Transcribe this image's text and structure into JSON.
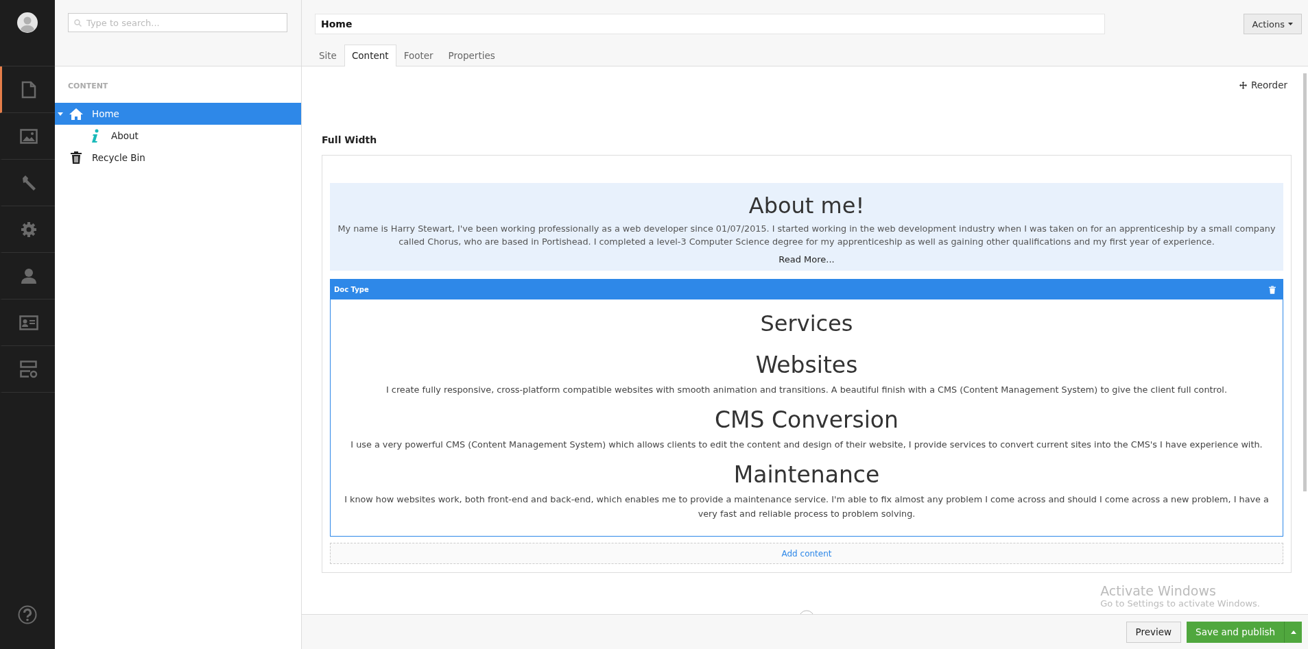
{
  "rail": {
    "items": [
      {
        "kind": "document",
        "selected": true
      },
      {
        "kind": "image",
        "selected": false
      },
      {
        "kind": "wrench",
        "selected": false
      },
      {
        "kind": "gear",
        "selected": false
      },
      {
        "kind": "user",
        "selected": false
      },
      {
        "kind": "card",
        "selected": false
      },
      {
        "kind": "server",
        "selected": false
      }
    ]
  },
  "search": {
    "placeholder": "Type to search..."
  },
  "tree": {
    "heading": "CONTENT",
    "items": [
      {
        "label": "Home",
        "kind": "home",
        "selected": true,
        "expanded": true,
        "children": [
          {
            "label": "About",
            "kind": "info",
            "selected": false
          }
        ]
      },
      {
        "label": "Recycle Bin",
        "kind": "trash",
        "selected": false
      }
    ]
  },
  "editor": {
    "title": "Home",
    "actions": "Actions",
    "tabs": [
      {
        "label": "Site",
        "selected": false
      },
      {
        "label": "Content",
        "selected": true
      },
      {
        "label": "Footer",
        "selected": false
      },
      {
        "label": "Properties",
        "selected": false
      }
    ],
    "reorder": "Reorder",
    "section": "Full Width",
    "blocks": [
      {
        "kind": "intro",
        "heading": "About me!",
        "text": "My name is Harry Stewart, I've been working professionally as a web developer since 01/07/2015. I started working in the web development industry when I was taken on for an apprenticeship by a small company called Chorus, who are based in Portishead. I completed a level-3 Computer Science degree for my apprenticeship as well as gaining other qualifications and my first year of experience.",
        "link": "Read More..."
      },
      {
        "kind": "doctype",
        "label": "Doc Type",
        "heading": "Services",
        "items": [
          {
            "heading": "Websites",
            "text": "I create fully responsive, cross-platform compatible websites with smooth animation and transitions. A beautiful finish with a CMS (Content Management System) to give the client full control."
          },
          {
            "heading": "CMS Conversion",
            "text": "I use a very powerful CMS (Content Management System) which allows clients to edit the content and design of their website, I provide services to convert current sites into the CMS's I have experience with."
          },
          {
            "heading": "Maintenance",
            "text": "I know how websites work, both front-end and back-end, which enables me to provide a maintenance service. I'm able to fix almost any problem I come across and should I come across a new problem, I have a very fast and reliable process to problem solving."
          }
        ]
      }
    ],
    "add_content": "Add content",
    "preview": "Preview",
    "save": "Save and publish"
  },
  "os_notice": {
    "title": "Activate Windows",
    "text": "Go to Settings to activate Windows."
  }
}
